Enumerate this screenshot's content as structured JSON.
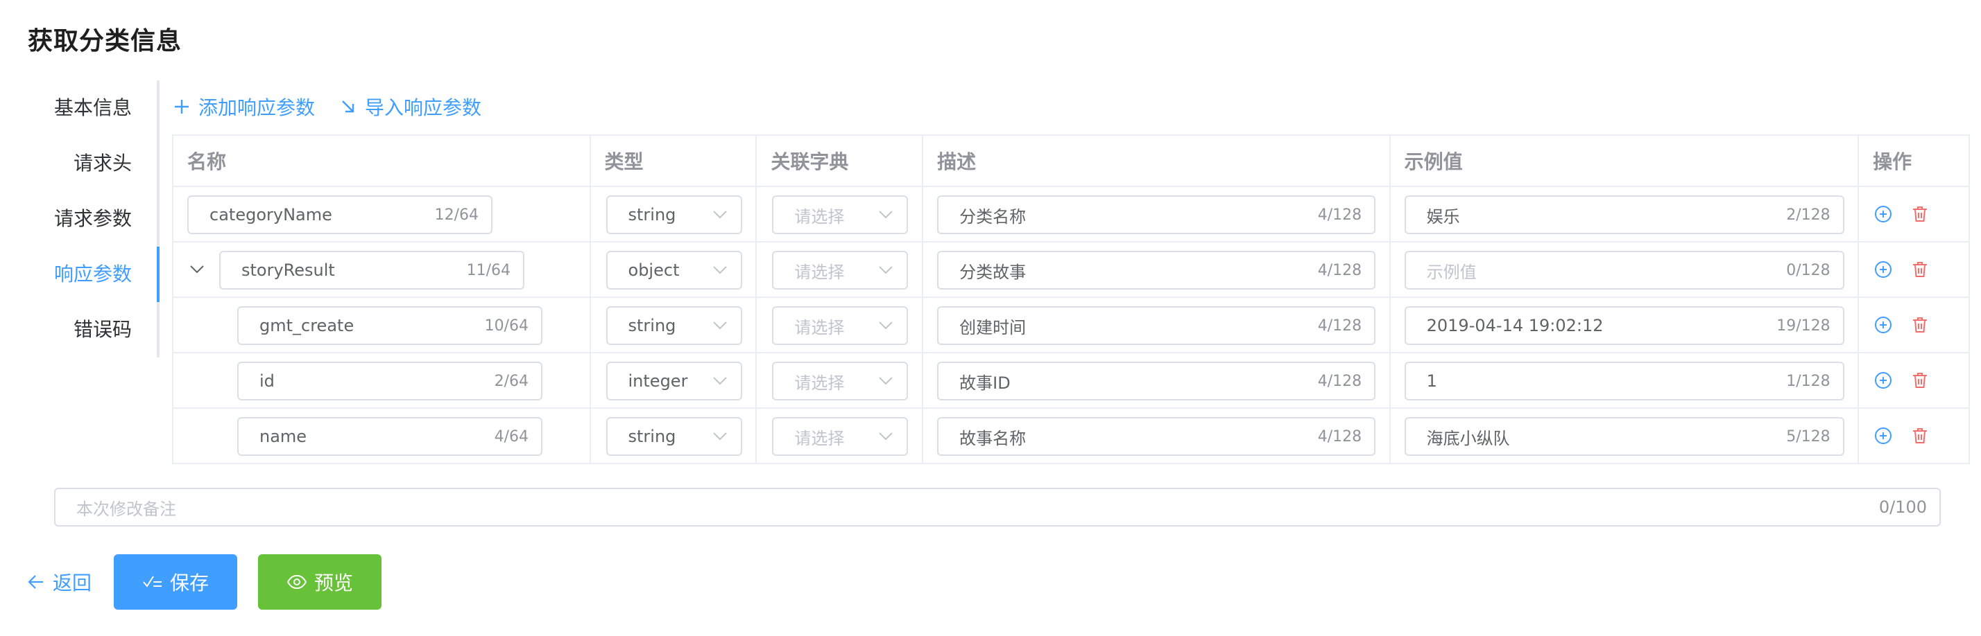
{
  "page_title": "获取分类信息",
  "nav": [
    "基本信息",
    "请求头",
    "请求参数",
    "响应参数",
    "错误码"
  ],
  "toolbar": {
    "add_label": "添加响应参数",
    "import_label": "导入响应参数"
  },
  "columns": {
    "name": "名称",
    "type": "类型",
    "dict": "关联字典",
    "desc": "描述",
    "example": "示例值",
    "ops": "操作"
  },
  "dict_placeholder": "请选择",
  "example_placeholder": "示例值",
  "rows": [
    {
      "name": "categoryName",
      "name_count": "12/64",
      "type": "string",
      "desc": "分类名称",
      "desc_count": "4/128",
      "example": "娱乐",
      "example_count": "2/128"
    },
    {
      "name": "storyResult",
      "name_count": "11/64",
      "type": "object",
      "desc": "分类故事",
      "desc_count": "4/128",
      "example": "",
      "example_count": "0/128"
    },
    {
      "name": "gmt_create",
      "name_count": "10/64",
      "type": "string",
      "desc": "创建时间",
      "desc_count": "4/128",
      "example": "2019-04-14 19:02:12",
      "example_count": "19/128"
    },
    {
      "name": "id",
      "name_count": "2/64",
      "type": "integer",
      "desc": "故事ID",
      "desc_count": "4/128",
      "example": "1",
      "example_count": "1/128"
    },
    {
      "name": "name",
      "name_count": "4/64",
      "type": "string",
      "desc": "故事名称",
      "desc_count": "4/128",
      "example": "海底小纵队",
      "example_count": "5/128"
    }
  ],
  "remark": {
    "placeholder": "本次修改备注",
    "count": "0/100"
  },
  "actions": {
    "back": "返回",
    "save": "保存",
    "preview": "预览"
  },
  "colors": {
    "accent": "#409eff",
    "success": "#67c23a",
    "danger": "#f56c6c"
  }
}
